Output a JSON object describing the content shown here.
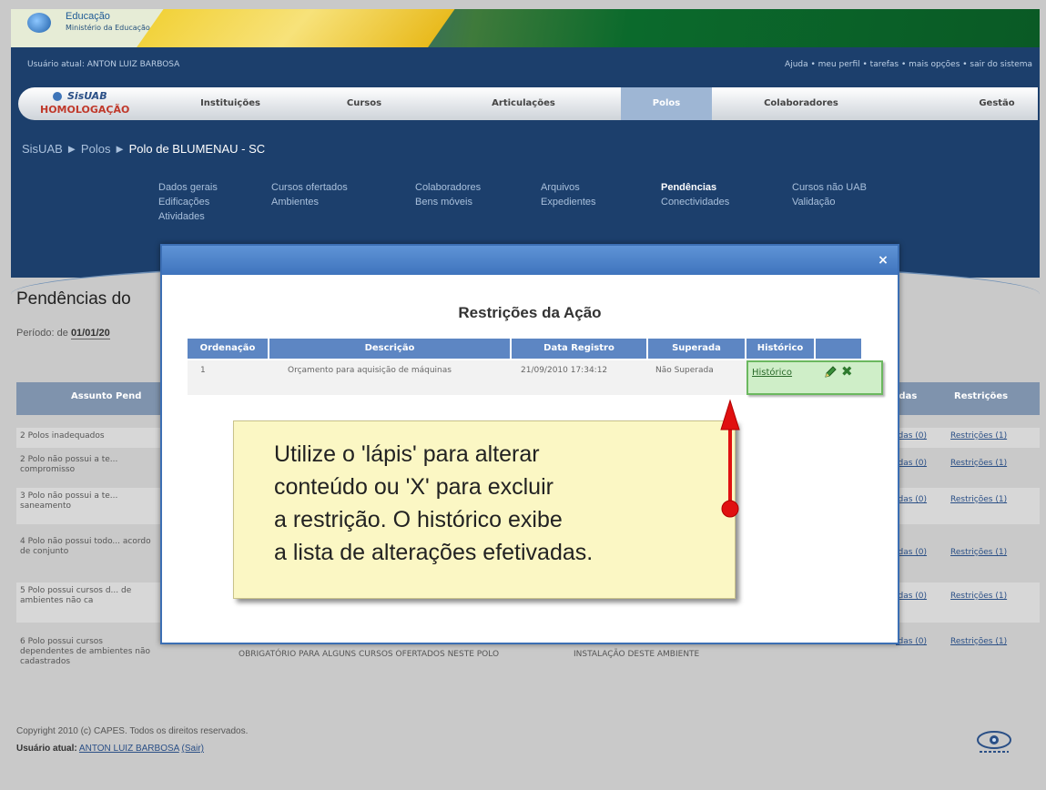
{
  "brand": {
    "title": "Educação",
    "subtitle": "Ministério da Educação"
  },
  "header": {
    "user_line": "Usuário atual: ANTON LUIZ BARBOSA",
    "top_links": "Ajuda • meu perfil • tarefas • mais opções • sair do sistema"
  },
  "nav": {
    "system_name": "SisUAB",
    "environment": "HOMOLOGAÇÃO",
    "tabs": [
      {
        "label": "Instituições"
      },
      {
        "label": "Cursos"
      },
      {
        "label": "Articulações"
      },
      {
        "label": "Polos"
      },
      {
        "label": "Colaboradores"
      },
      {
        "label": "Gestão"
      }
    ],
    "active_tab": "Polos"
  },
  "breadcrumb": {
    "root": "SisUAB",
    "section": "Polos",
    "current": "Polo de BLUMENAU - SC",
    "separator": "►"
  },
  "submenu": {
    "items": [
      "Dados gerais",
      "Cursos ofertados",
      "Colaboradores",
      "Arquivos",
      "Pendências",
      "Cursos não UAB",
      "Edificações",
      "Ambientes",
      "Bens móveis",
      "Expedientes",
      "Conectividades",
      "Validação",
      "Atividades"
    ],
    "active": "Pendências"
  },
  "page": {
    "title": "Pendências do",
    "period_label": "Período: de",
    "period_start": "01/01/20"
  },
  "background_table": {
    "columns": [
      "Assunto Pend",
      "idas",
      "Restrições"
    ],
    "rows": [
      {
        "text": "2 Polos inadequados",
        "link1": "idas (0)",
        "link2": "Restrições (1)"
      },
      {
        "text": "2 Polo não possui a te... compromisso",
        "link1": "idas (0)",
        "link2": "Restrições (1)"
      },
      {
        "text": "3 Polo não possui a te... saneamento",
        "link1": "idas (0)",
        "link2": "Restrições (1)"
      },
      {
        "text": "4 Polo não possui todo... acordo de conjunto",
        "link1": "idas (0)",
        "link2": "Restrições (1)"
      },
      {
        "text": "5 Polo possui cursos d... de ambientes não ca",
        "link1": "idas (0)",
        "link2": "Restrições (1)"
      },
      {
        "text": "6 Polo possui cursos dependentes de ambientes não cadastrados",
        "link1": "idas (0)",
        "link2": "Restrições (1)",
        "col2": "OBRIGATÓRIO PARA ALGUNS CURSOS OFERTADOS NESTE POLO",
        "col3": "INSTALAÇÃO DESTE AMBIENTE"
      }
    ]
  },
  "modal": {
    "title": "Restrições da Ação",
    "close_label": "×",
    "columns": [
      "Ordenação",
      "Descrição",
      "Data Registro",
      "Superada",
      "Histórico"
    ],
    "row": {
      "order": "1",
      "description": "Orçamento para aquisição de máquinas",
      "date": "21/09/2010 17:34:12",
      "superada": "Não Superada",
      "historico": "Histórico"
    }
  },
  "callout": {
    "text": "Utilize o 'lápis' para alterar\nconteúdo ou 'X' para excluir\na restrição. O histórico exibe\na lista de alterações efetivadas."
  },
  "footer": {
    "copyright": "Copyright 2010 (c) CAPES. Todos os direitos reservados.",
    "user_label": "Usuário atual:",
    "user_name": "ANTON LUIZ BARBOSA",
    "logout": "(Sair)"
  },
  "colors": {
    "header_blue": "#1c3f6c",
    "modal_bar": "#4a80c8",
    "callout_bg": "#fbf7c4",
    "arrow_red": "#e01010"
  }
}
